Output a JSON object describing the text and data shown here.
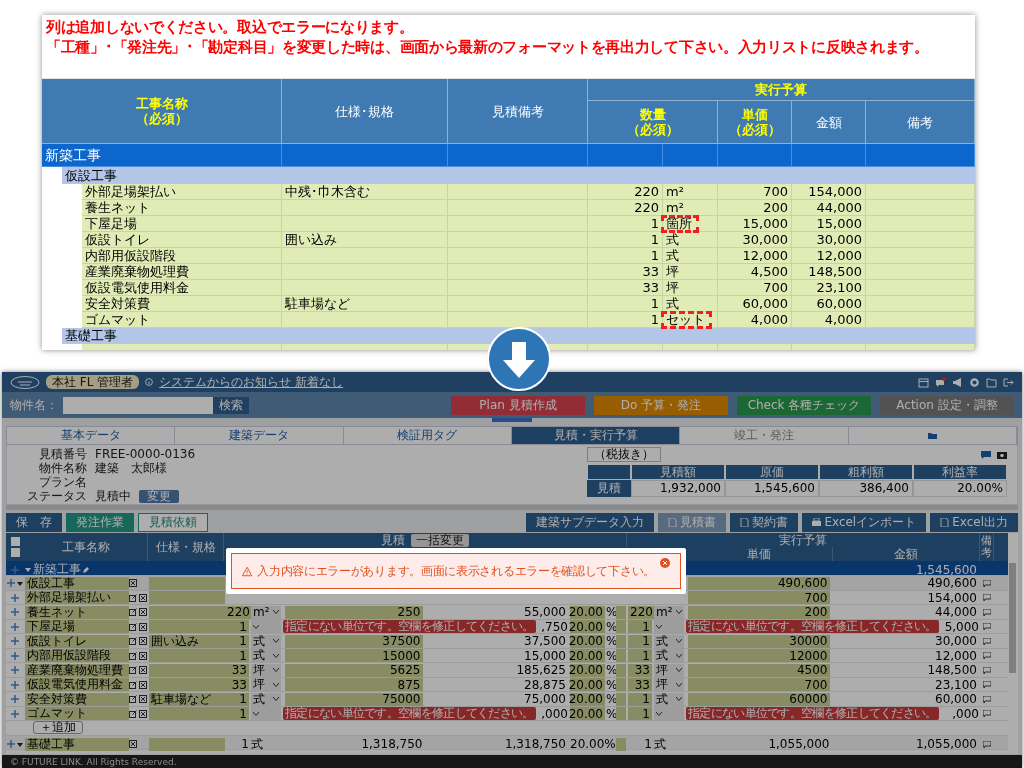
{
  "sheet": {
    "notes": [
      "列は追加しないでください。取込でエラーになります。",
      "「工種」･「発注先」･「勘定科目」を変更した時は、画面から最新のフォーマットを再出力して下さい。入力リストに反映されます。"
    ],
    "header": {
      "name": {
        "label": "工事名称",
        "note": "（必須）",
        "highlight": true
      },
      "spec": {
        "label": "仕様･規格",
        "highlight": false
      },
      "estimate_note": {
        "label": "見積備考",
        "highlight": false
      },
      "budget": {
        "label": "実行予算",
        "highlight": true
      },
      "sub": [
        {
          "label": "数量",
          "note": "（必須）",
          "highlight": true
        },
        {
          "label": "単価",
          "note": "（必須）",
          "highlight": true
        },
        {
          "label": "金額",
          "highlight": false
        },
        {
          "label": "備考",
          "highlight": false
        }
      ]
    },
    "rows": [
      {
        "kind": "major",
        "name": "新築工事",
        "children": [
          {
            "kind": "minor",
            "name": "仮設工事",
            "children": [
              {
                "kind": "item",
                "name": "外部足場架払い",
                "spec": "中残･巾木含む",
                "qty": "220",
                "unit": "m²",
                "price": "700",
                "amount": "154,000",
                "flagged": false
              },
              {
                "kind": "item",
                "name": "養生ネット",
                "qty": "220",
                "unit": "m²",
                "price": "200",
                "amount": "44,000",
                "flagged": false
              },
              {
                "kind": "item",
                "name": "下屋足場",
                "qty": "1",
                "unit": "箇所",
                "price": "15,000",
                "amount": "15,000",
                "flagged": true
              },
              {
                "kind": "item",
                "name": "仮設トイレ",
                "spec": "囲い込み",
                "qty": "1",
                "unit": "式",
                "price": "30,000",
                "amount": "30,000",
                "flagged": false
              },
              {
                "kind": "item",
                "name": "内部用仮設階段",
                "qty": "1",
                "unit": "式",
                "price": "12,000",
                "amount": "12,000",
                "flagged": false
              },
              {
                "kind": "item",
                "name": "産業廃棄物処理費",
                "qty": "33",
                "unit": "坪",
                "price": "4,500",
                "amount": "148,500",
                "flagged": false
              },
              {
                "kind": "item",
                "name": "仮設電気使用料金",
                "qty": "33",
                "unit": "坪",
                "price": "700",
                "amount": "23,100",
                "flagged": false
              },
              {
                "kind": "item",
                "name": "安全対策費",
                "spec": "駐車場など",
                "qty": "1",
                "unit": "式",
                "price": "60,000",
                "amount": "60,000",
                "flagged": false
              },
              {
                "kind": "item",
                "name": "ゴムマット",
                "qty": "1",
                "unit": "セット",
                "price": "4,000",
                "amount": "4,000",
                "flagged": true
              }
            ]
          },
          {
            "kind": "minor",
            "name": "基礎工事",
            "children": [
              {
                "kind": "item"
              }
            ]
          }
        ]
      }
    ]
  },
  "app": {
    "badge": "本社 FL 管理者",
    "notice": "システムからのお知らせ 新着なし",
    "search": {
      "label": "物件名：",
      "button": "検索"
    },
    "phases": [
      {
        "kind": "plan",
        "label": "Plan",
        "sub": "見積作成"
      },
      {
        "kind": "do",
        "label": "Do",
        "sub": "予算・発注"
      },
      {
        "kind": "check",
        "label": "Check",
        "sub": "各種チェック"
      },
      {
        "kind": "action",
        "label": "Action",
        "sub": "設定・調整"
      }
    ],
    "tabs": [
      {
        "kind": "text",
        "label": "基本データ",
        "selected": false,
        "disabled": false
      },
      {
        "kind": "text",
        "label": "建築データ",
        "selected": false,
        "disabled": false
      },
      {
        "kind": "text",
        "label": "検証用タグ",
        "selected": false,
        "disabled": false
      },
      {
        "kind": "text",
        "label": "見積・実行予算",
        "selected": true,
        "disabled": false
      },
      {
        "kind": "text",
        "label": "竣工・発注",
        "selected": false,
        "disabled": true
      },
      {
        "kind": "folder",
        "selected": false,
        "disabled": false
      }
    ],
    "info": [
      {
        "label": "見積番号",
        "value": "FREE-0000-0136"
      },
      {
        "label": "物件名称",
        "value": "建築　太郎様"
      },
      {
        "label": "プラン名"
      },
      {
        "label": "ステータス",
        "value": "見積中",
        "button": "変更"
      }
    ],
    "tax": "（税抜き）",
    "summary": {
      "columns": [
        "見積額",
        "原価",
        "粗利額",
        "利益率"
      ],
      "row_label": "見積",
      "values": [
        "1,932,000",
        "1,545,600",
        "386,400",
        "20.00%"
      ]
    },
    "actions_left": [
      {
        "kind": "primary",
        "label": "保　存"
      },
      {
        "kind": "teal",
        "label": "発注作業"
      },
      {
        "kind": "outline",
        "label": "見積依頼"
      }
    ],
    "actions_right": [
      {
        "kind": "plain",
        "label": "建築サブデータ入力",
        "disabled": false
      },
      {
        "kind": "doc",
        "label": "見積書",
        "disabled": true
      },
      {
        "kind": "doc",
        "label": "契約書",
        "disabled": false
      },
      {
        "kind": "printer",
        "label": "Excelインポート",
        "disabled": false
      },
      {
        "kind": "doc",
        "label": "Excel出力",
        "disabled": false
      }
    ],
    "table": {
      "name": "工事名称",
      "spec": "仕様・規格",
      "estimate": "見積",
      "bulk": "一括変更",
      "budget": "実行予算",
      "note": "備考",
      "price": "単価",
      "amount": "金額",
      "rows": [
        {
          "kind": "major",
          "name": "新築工事",
          "exec_amount": "1,545,600"
        },
        {
          "kind": "group",
          "name": "仮設工事",
          "exec_price": "490,600",
          "exec_amount": "490,600"
        },
        {
          "kind": "item",
          "name": "外部足場架払い",
          "exec_price": "700",
          "exec_amount": "154,000"
        },
        {
          "kind": "item",
          "name": "養生ネット",
          "qty": "220",
          "unit": "m²",
          "price": "250",
          "amount": "55,000",
          "rate": "20.00",
          "pct": "%",
          "exec_qty": "220",
          "exec_unit": "m²",
          "exec_price": "200",
          "exec_amount": "44,000"
        },
        {
          "kind": "item",
          "name": "下屋足場",
          "qty": "1",
          "error": "指定にない単位です。空欄を修正してください。",
          "amount": ",750",
          "rate": "20.00",
          "pct": "%",
          "exec_qty": "1",
          "exec_error": "指定にない単位です。空欄を修正してください。",
          "exec_amount": "5,000"
        },
        {
          "kind": "item",
          "name": "仮設トイレ",
          "spec": "囲い込み",
          "qty": "1",
          "unit": "式",
          "price": "37500",
          "amount": "37,500",
          "rate": "20.00",
          "pct": "%",
          "exec_qty": "1",
          "exec_unit": "式",
          "exec_price": "30000",
          "exec_amount": "30,000"
        },
        {
          "kind": "item",
          "name": "内部用仮設階段",
          "qty": "1",
          "unit": "式",
          "price": "15000",
          "amount": "15,000",
          "rate": "20.00",
          "pct": "%",
          "exec_qty": "1",
          "exec_unit": "式",
          "exec_price": "12000",
          "exec_amount": "12,000"
        },
        {
          "kind": "item",
          "name": "産業廃棄物処理費",
          "qty": "33",
          "unit": "坪",
          "price": "5625",
          "amount": "185,625",
          "rate": "20.00",
          "pct": "%",
          "exec_qty": "33",
          "exec_unit": "坪",
          "exec_price": "4500",
          "exec_amount": "148,500"
        },
        {
          "kind": "item",
          "name": "仮設電気使用料金",
          "qty": "33",
          "unit": "坪",
          "price": "875",
          "amount": "28,875",
          "rate": "20.00",
          "pct": "%",
          "exec_qty": "33",
          "exec_unit": "坪",
          "exec_price": "700",
          "exec_amount": "23,100"
        },
        {
          "kind": "item",
          "name": "安全対策費",
          "spec": "駐車場など",
          "qty": "1",
          "unit": "式",
          "price": "75000",
          "amount": "75,000",
          "rate": "20.00",
          "pct": "%",
          "exec_qty": "1",
          "exec_unit": "式",
          "exec_price": "60000",
          "exec_amount": "60,000"
        },
        {
          "kind": "item",
          "name": "ゴムマット",
          "qty": "1",
          "error": "指定にない単位です。空欄を修正してください。",
          "amount": ",000",
          "rate": "20.00",
          "pct": "%",
          "exec_qty": "1",
          "exec_error": "指定にない単位です。空欄を修正してください。",
          "exec_amount": ",000"
        },
        {
          "kind": "add",
          "name": "＋追加"
        },
        {
          "kind": "group",
          "name": "基礎工事",
          "qty": "1",
          "unit": "式",
          "price": "1,318,750",
          "amount": "1,318,750",
          "rate": "20.00%",
          "exec_qty": "1",
          "exec_unit": "式",
          "exec_price": "1,055,000",
          "exec_amount": "1,055,000"
        }
      ]
    },
    "modal": {
      "message": "入力内容にエラーがあります。画面に表示されるエラーを確認して下さい。"
    },
    "footer": "© FUTURE LINK. All Rights Reserved."
  }
}
